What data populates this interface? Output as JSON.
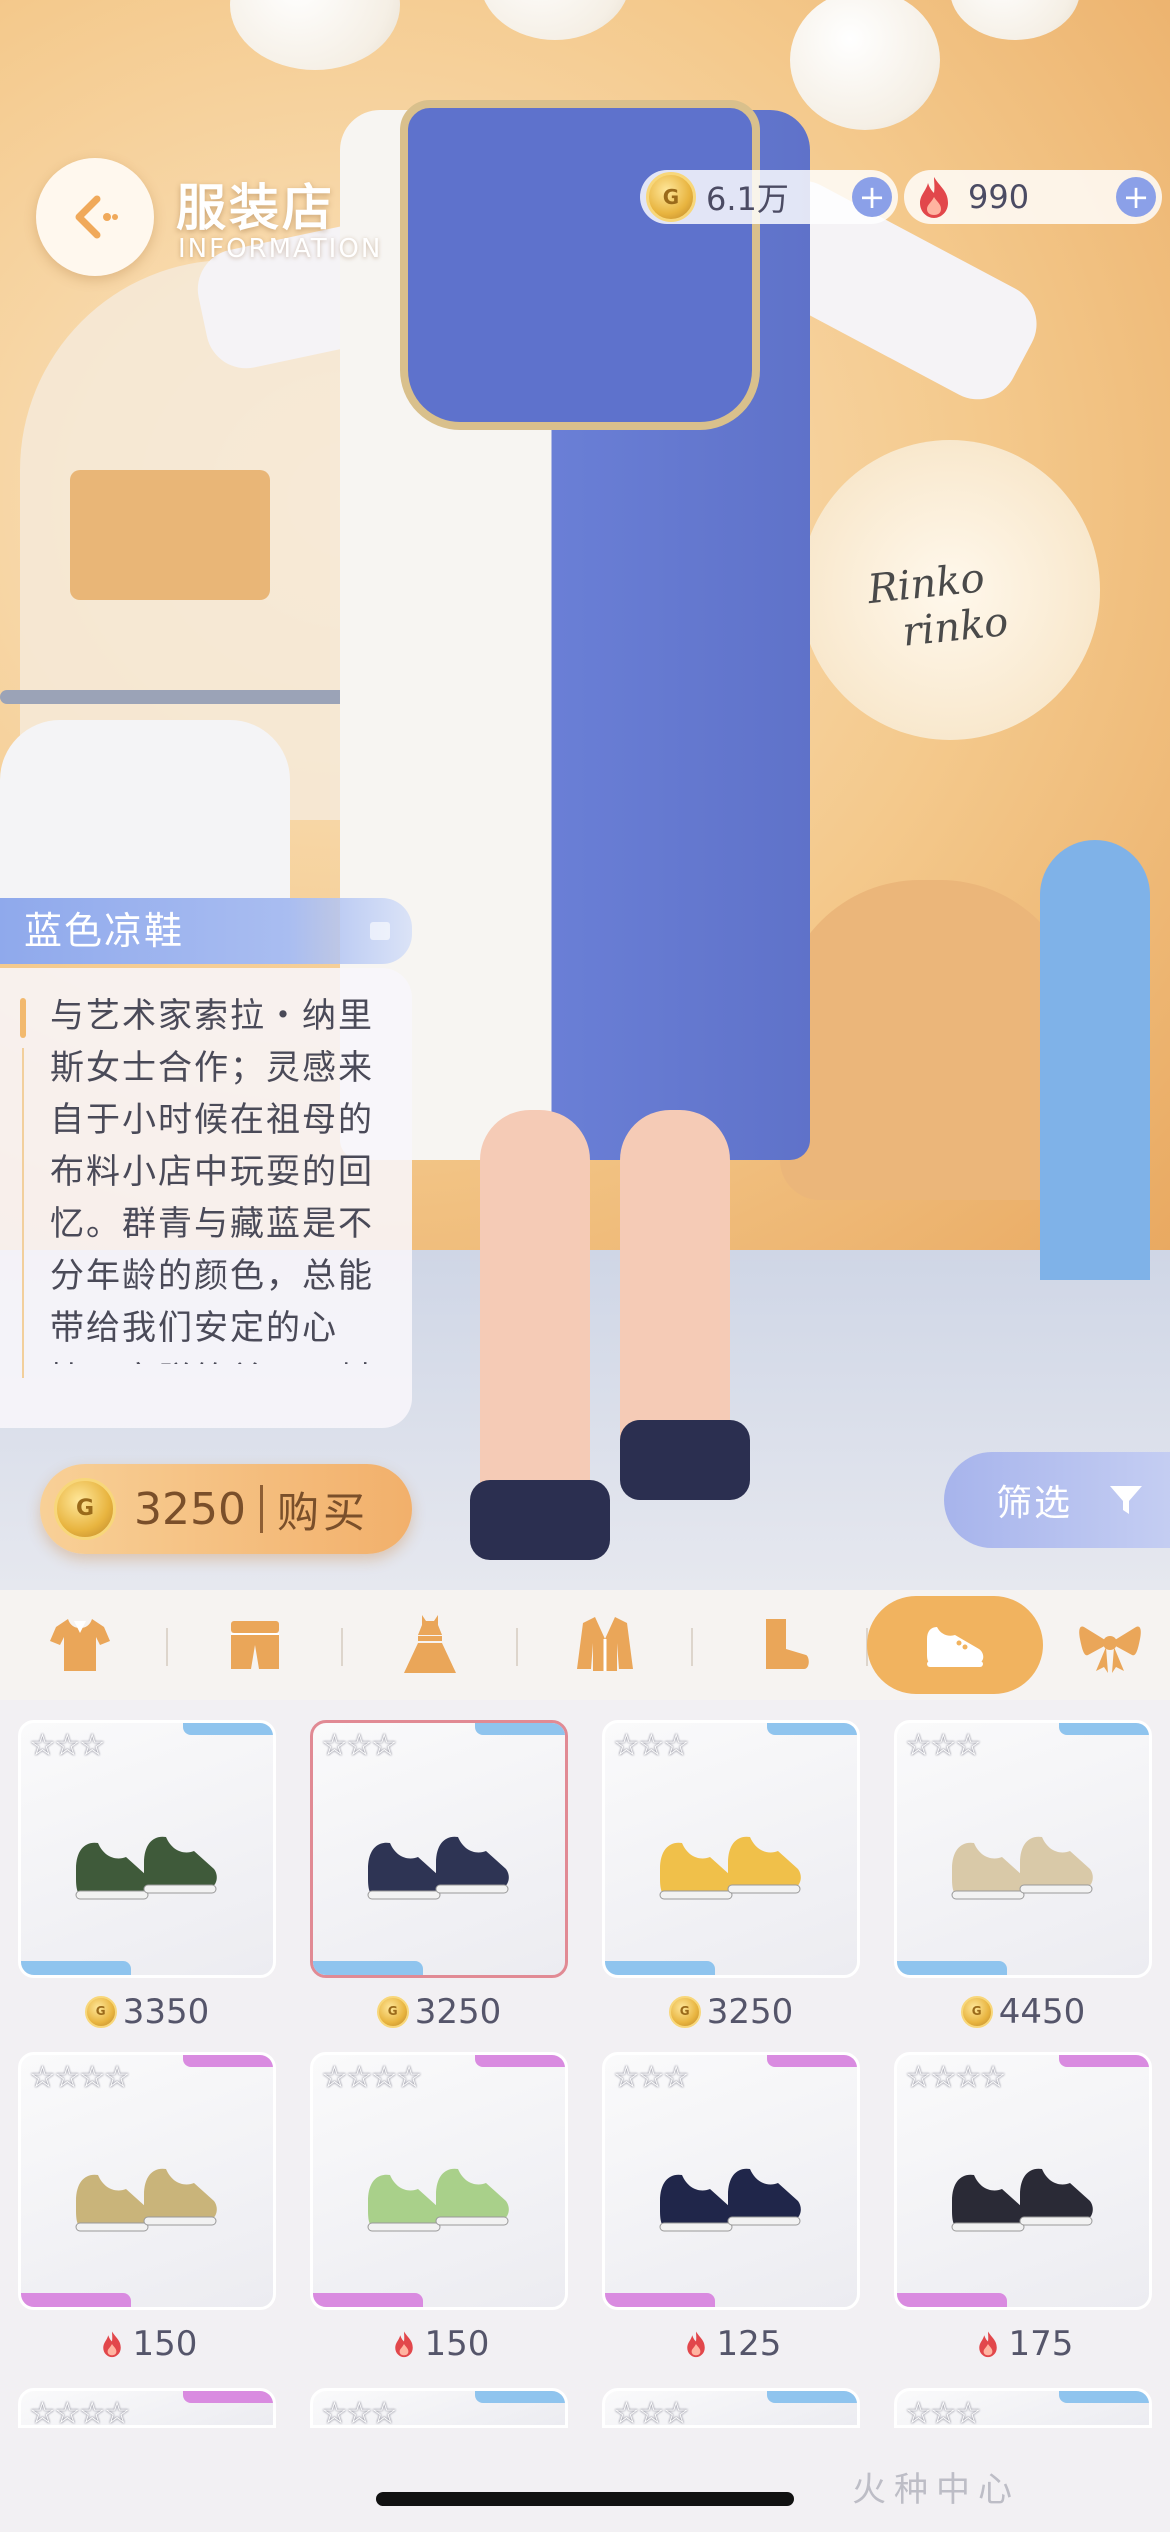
{
  "header": {
    "title": "服装店",
    "subtitle": "INFORMATION"
  },
  "currency": {
    "gold": "6.1万",
    "gems": "990"
  },
  "scene": {
    "sign_line1": "Rinko",
    "sign_line2": "rinko"
  },
  "item": {
    "name": "蓝色凉鞋",
    "description": "与艺术家索拉・纳里斯女士合作；灵感来自于小时候在祖母的布料小店中玩耍的回忆。群青与藏蓝是不分年龄的颜色，总能带给我们安定的心情，穿脱简单，面料",
    "price": "3250",
    "buy_label": "购买"
  },
  "filter": {
    "label": "筛选"
  },
  "categories": [
    {
      "icon": "tshirt-icon",
      "active": false
    },
    {
      "icon": "pants-icon",
      "active": false
    },
    {
      "icon": "dress-icon",
      "active": false
    },
    {
      "icon": "jacket-icon",
      "active": false
    },
    {
      "icon": "sock-icon",
      "active": false
    },
    {
      "icon": "shoe-icon",
      "active": true
    },
    {
      "icon": "bow-icon",
      "active": false
    }
  ],
  "items": [
    {
      "stars": "☆☆☆",
      "price": "3350",
      "currency": "gold",
      "rarity": "blue",
      "color": "#3f5a3a",
      "selected": false
    },
    {
      "stars": "☆☆☆",
      "price": "3250",
      "currency": "gold",
      "rarity": "blue",
      "color": "#2e3454",
      "selected": true
    },
    {
      "stars": "☆☆☆",
      "price": "3250",
      "currency": "gold",
      "rarity": "blue",
      "color": "#f0c04a",
      "selected": false
    },
    {
      "stars": "☆☆☆",
      "price": "4450",
      "currency": "gold",
      "rarity": "blue",
      "color": "#d9c9a8",
      "selected": false
    },
    {
      "stars": "☆☆☆☆",
      "price": "150",
      "currency": "gem",
      "rarity": "pink",
      "color": "#c9b47a",
      "selected": false
    },
    {
      "stars": "☆☆☆☆",
      "price": "150",
      "currency": "gem",
      "rarity": "pink",
      "color": "#a9d08a",
      "selected": false
    },
    {
      "stars": "☆☆☆",
      "price": "125",
      "currency": "gem",
      "rarity": "pink",
      "color": "#20264a",
      "selected": false
    },
    {
      "stars": "☆☆☆☆",
      "price": "175",
      "currency": "gem",
      "rarity": "pink",
      "color": "#2a2a36",
      "selected": false
    }
  ],
  "partial_items": [
    {
      "stars": "☆☆☆☆",
      "rarity": "pink"
    },
    {
      "stars": "☆☆☆",
      "rarity": "blue"
    },
    {
      "stars": "☆☆☆",
      "rarity": "blue"
    },
    {
      "stars": "☆☆☆",
      "rarity": "blue"
    }
  ],
  "watermark": "火种中心",
  "colors": {
    "accent": "#f1b35f",
    "selection": "#e18a94",
    "panel_blue": "#8fa9ec"
  }
}
